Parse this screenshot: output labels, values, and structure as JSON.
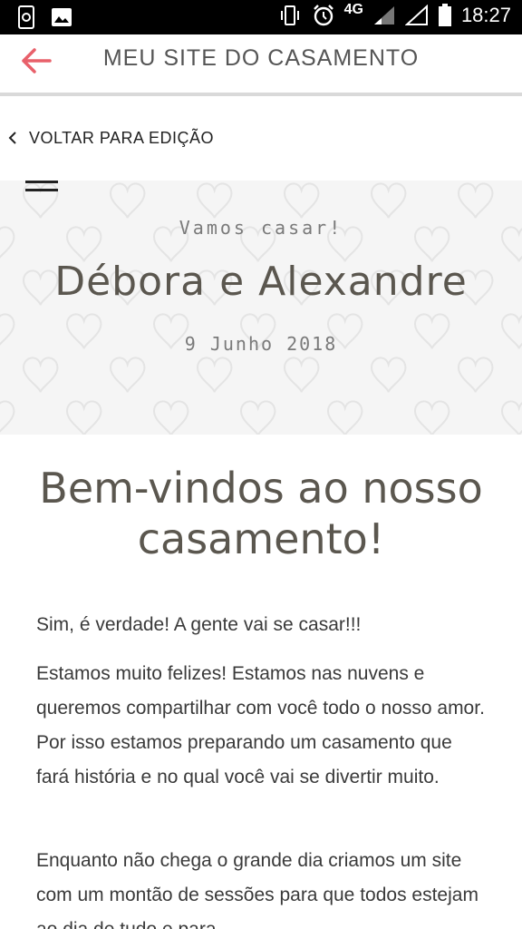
{
  "status_bar": {
    "network": "4G",
    "time": "18:27",
    "icons": [
      "sync-icon",
      "image-icon",
      "vibrate-icon",
      "alarm-icon",
      "signal-icon",
      "signal-icon",
      "battery-icon"
    ]
  },
  "app_bar": {
    "title": "MEU SITE DO CASAMENTO",
    "back_icon": "arrow-left-icon",
    "accent": "#e8606a"
  },
  "edit_bar": {
    "label": "VOLTAR PARA EDIÇÃO",
    "icon": "chevron-left-icon"
  },
  "hero": {
    "tagline": "Vamos casar!",
    "names": "Débora e Alexandre",
    "date": "9 Junho 2018",
    "menu_icon": "hamburger-icon",
    "pattern": "heart-icon"
  },
  "content": {
    "heading": "Bem-vindos ao nosso casamento!",
    "paragraphs": [
      "Sim, é verdade! A gente vai se casar!!!",
      "Estamos muito felizes! Estamos nas nuvens e queremos compartilhar com você todo o nosso amor. Por isso estamos preparando um casamento que fará história e no qual você vai se divertir muito.",
      "Enquanto não chega o grande dia criamos um site com um montão de sessões para que todos estejam ao dia de tudo e para"
    ]
  }
}
